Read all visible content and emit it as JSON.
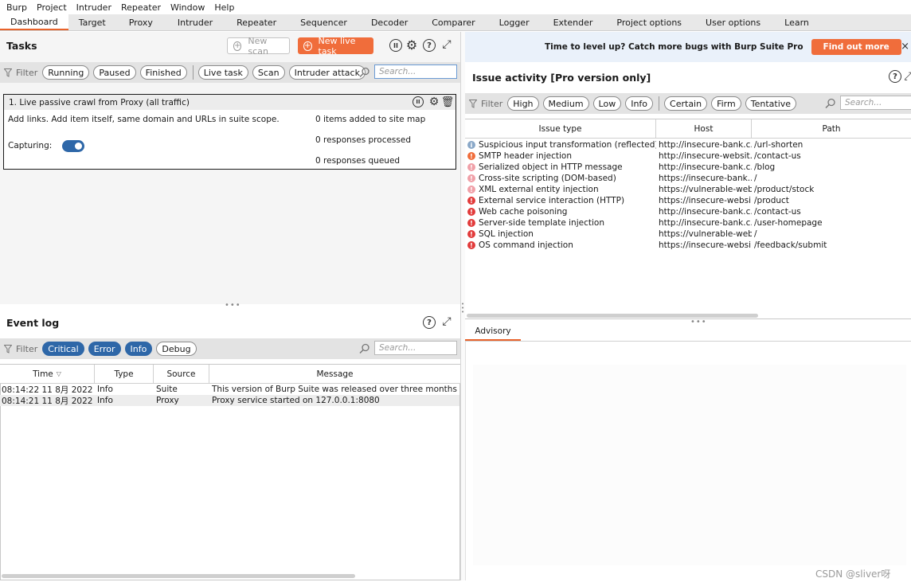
{
  "menu": [
    "Burp",
    "Project",
    "Intruder",
    "Repeater",
    "Window",
    "Help"
  ],
  "tabs": [
    {
      "label": "Dashboard",
      "active": true
    },
    {
      "label": "Target"
    },
    {
      "label": "Proxy"
    },
    {
      "label": "Intruder"
    },
    {
      "label": "Repeater"
    },
    {
      "label": "Sequencer"
    },
    {
      "label": "Decoder"
    },
    {
      "label": "Comparer"
    },
    {
      "label": "Logger"
    },
    {
      "label": "Extender"
    },
    {
      "label": "Project options"
    },
    {
      "label": "User options"
    },
    {
      "label": "Learn"
    }
  ],
  "tasks": {
    "title": "Tasks",
    "new_scan": "New scan",
    "new_live_task": "New live task",
    "filter_label": "Filter",
    "filters": [
      "Running",
      "Paused",
      "Finished"
    ],
    "filters2": [
      "Live task",
      "Scan",
      "Intruder attack"
    ],
    "search_placeholder": "Search...",
    "task": {
      "name": "1.  Live passive crawl from Proxy (all traffic)",
      "description": "Add links. Add item itself, same domain and URLs in suite scope.",
      "capturing_label": "Capturing:",
      "stat1": "0 items added to site map",
      "stat2": "0 responses processed",
      "stat3": "0 responses queued"
    }
  },
  "eventlog": {
    "title": "Event log",
    "filter_label": "Filter",
    "filters": [
      {
        "label": "Critical",
        "on": true
      },
      {
        "label": "Error",
        "on": true
      },
      {
        "label": "Info",
        "on": true
      },
      {
        "label": "Debug",
        "on": false
      }
    ],
    "search_placeholder": "Search...",
    "columns": [
      "Time",
      "Type",
      "Source",
      "Message"
    ],
    "rows": [
      {
        "time": "08:14:22 11 8月 2022",
        "type": "Info",
        "source": "Suite",
        "message": "This version of Burp Suite was released over three months ago. Please"
      },
      {
        "time": "08:14:21 11 8月 2022",
        "type": "Info",
        "source": "Proxy",
        "message": "Proxy service started on 127.0.0.1:8080"
      }
    ]
  },
  "banner": {
    "text": "Time to level up? Catch more bugs with Burp Suite Pro",
    "button": "Find out more",
    "close": "×"
  },
  "issues": {
    "title": "Issue activity [Pro version only]",
    "filter_label": "Filter",
    "filters": [
      "High",
      "Medium",
      "Low",
      "Info"
    ],
    "filters2": [
      "Certain",
      "Firm",
      "Tentative"
    ],
    "search_placeholder": "Search...",
    "columns": [
      "Issue type",
      "Host",
      "Path"
    ],
    "rows": [
      {
        "sev": "info",
        "type": "Suspicious input transformation (reflected)",
        "host": "http://insecure-bank.c...",
        "path": "/url-shorten"
      },
      {
        "sev": "medium",
        "type": "SMTP header injection",
        "host": "http://insecure-websit...",
        "path": "/contact-us"
      },
      {
        "sev": "low",
        "type": "Serialized object in HTTP message",
        "host": "http://insecure-bank.c...",
        "path": "/blog"
      },
      {
        "sev": "low",
        "type": "Cross-site scripting (DOM-based)",
        "host": "https://insecure-bank....",
        "path": "/"
      },
      {
        "sev": "low",
        "type": "XML external entity injection",
        "host": "https://vulnerable-web...",
        "path": "/product/stock"
      },
      {
        "sev": "high",
        "type": "External service interaction (HTTP)",
        "host": "https://insecure-websi...",
        "path": "/product"
      },
      {
        "sev": "high",
        "type": "Web cache poisoning",
        "host": "http://insecure-bank.c...",
        "path": "/contact-us"
      },
      {
        "sev": "high",
        "type": "Server-side template injection",
        "host": "http://insecure-bank.c...",
        "path": "/user-homepage"
      },
      {
        "sev": "high",
        "type": "SQL injection",
        "host": "https://vulnerable-web...",
        "path": "/"
      },
      {
        "sev": "high",
        "type": "OS command injection",
        "host": "https://insecure-websi...",
        "path": "/feedback/submit"
      }
    ],
    "advisory_tab": "Advisory"
  },
  "colors": {
    "accent_orange": "#f06d3b",
    "pill_blue": "#2e67a8",
    "sev_high": "#e23b3b",
    "sev_medium": "#f06d3b",
    "sev_low": "#f0a0a8",
    "sev_info": "#8aa8c8"
  },
  "watermark": "CSDN @sliver呀"
}
